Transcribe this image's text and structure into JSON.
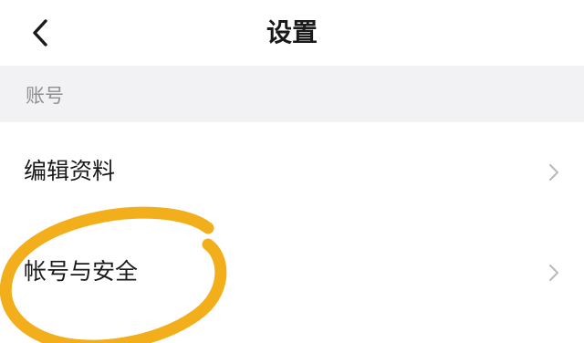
{
  "header": {
    "title": "设置",
    "back_icon": "chevron-left-icon"
  },
  "section": {
    "label": "账号"
  },
  "rows": [
    {
      "label": "编辑资料",
      "icon": "chevron-right-icon"
    },
    {
      "label": "帐号与安全",
      "icon": "chevron-right-icon"
    }
  ],
  "colors": {
    "highlight": "#f2ae1b",
    "section_bg": "#f2f2f4",
    "chevron": "#b8b8bd"
  }
}
